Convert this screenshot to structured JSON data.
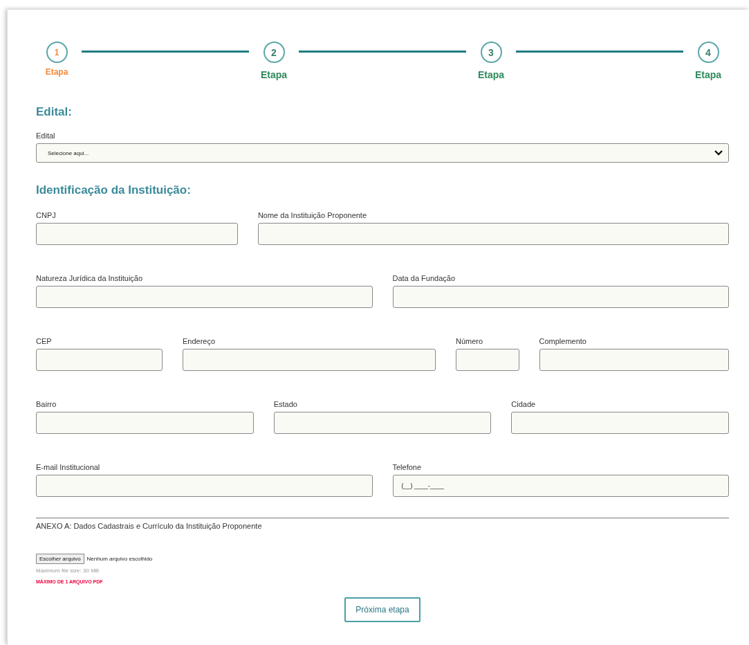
{
  "steps": [
    {
      "number": "1",
      "label": "Etapa",
      "selected": true
    },
    {
      "number": "2",
      "label": "Etapa",
      "selected": false
    },
    {
      "number": "3",
      "label": "Etapa",
      "selected": false
    },
    {
      "number": "4",
      "label": "Etapa",
      "selected": false
    }
  ],
  "edital_section": {
    "heading": "Edital:",
    "label": "Edital",
    "value": "Selecione aqui..."
  },
  "institution_section": {
    "heading": "Identificação da Instituição:",
    "rows": [
      {
        "fields": [
          {
            "label": "CNPJ"
          },
          {
            "label": "Nome da Instituição Proponente"
          }
        ]
      },
      {
        "fields": [
          {
            "label": "Natureza Jurídica da Instituição"
          },
          {
            "label": "Data da Fundação"
          }
        ]
      },
      {
        "fields": [
          {
            "label": "CEP"
          },
          {
            "label": "Endereço"
          },
          {
            "label": "Número"
          },
          {
            "label": "Complemento"
          }
        ]
      },
      {
        "fields": [
          {
            "label": "Bairro"
          },
          {
            "label": "Estado"
          },
          {
            "label": "Cidade"
          }
        ]
      },
      {
        "fields": [
          {
            "label": "E-mail Institucional"
          },
          {
            "label": "Telefone",
            "value": "(__) ____-____"
          }
        ]
      }
    ]
  },
  "attachment": {
    "label": "ANEXO A: Dados Cadastrais e Currículo da Instituição Proponente",
    "button": "Escolher arquivo",
    "status": "Nenhum arquivo escolhido",
    "size_note": "Maximum file size: 30 MB",
    "warning": "MÁXIMO DE 1 ARQUIVO PDF"
  },
  "next_button": "Próxima etapa"
}
